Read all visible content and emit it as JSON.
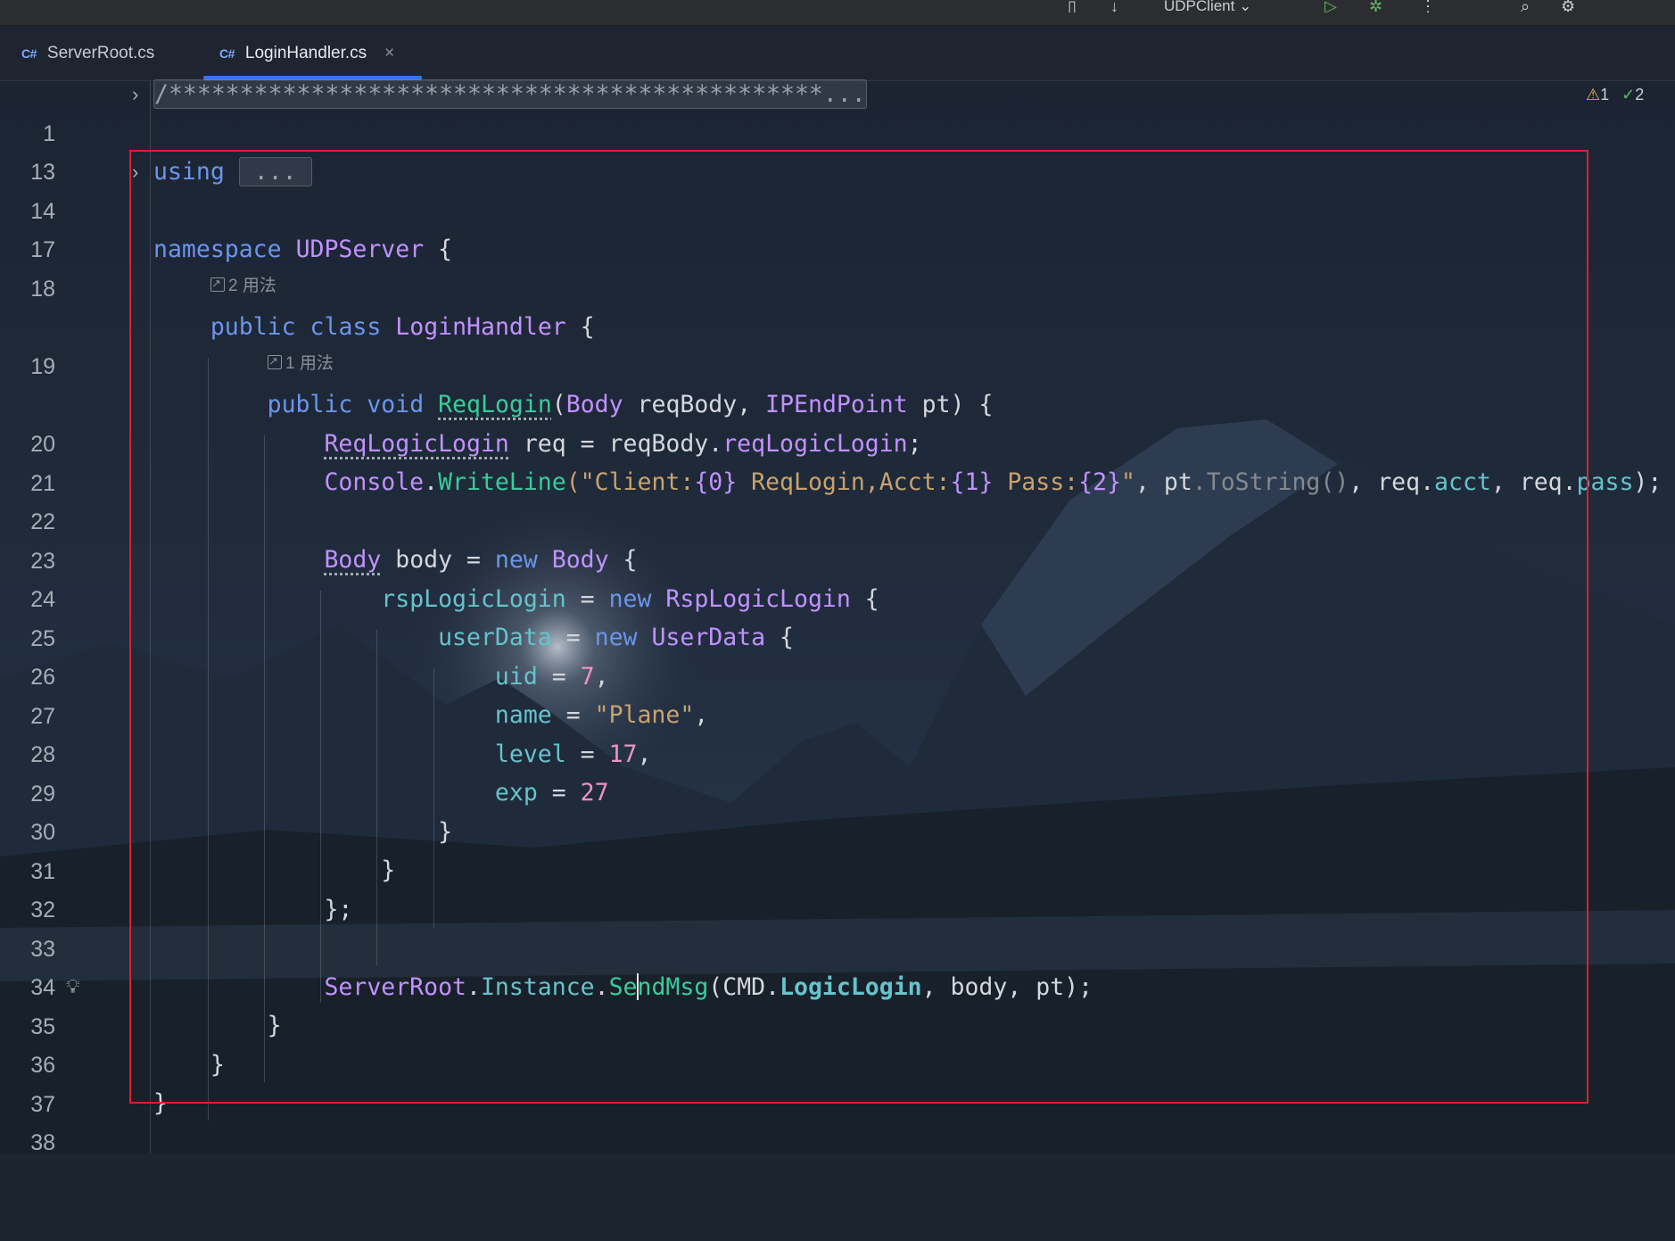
{
  "toolbar": {
    "run_config": "UDPClient"
  },
  "tabs": [
    {
      "icon": "C#",
      "label": "ServerRoot.cs",
      "active": false
    },
    {
      "icon": "C#",
      "label": "LoginHandler.cs",
      "active": true,
      "close": "×"
    }
  ],
  "inspections": {
    "warnings": "1",
    "weak_warnings": "2"
  },
  "hints": {
    "usages_class": "2 用法",
    "usages_method": "1 用法"
  },
  "line_numbers": [
    "1",
    "13",
    "14",
    "17",
    "18",
    "19",
    "20",
    "21",
    "22",
    "23",
    "24",
    "25",
    "26",
    "27",
    "28",
    "29",
    "30",
    "31",
    "32",
    "33",
    "34",
    "35",
    "36",
    "37",
    "38"
  ],
  "code": {
    "l1": "/**********************************************...",
    "l14_kw": "using",
    "l14_fold": " ... ",
    "l18_kw": "namespace",
    "l18_ns": "UDPServer",
    "l18_brace": " {",
    "l19_kw1": "public",
    "l19_kw2": "class",
    "l19_type": "LoginHandler",
    "l19_brace": " {",
    "l20_kw1": "public",
    "l20_kw2": "void",
    "l20_method": "ReqLogin",
    "l20_p1": "(",
    "l20_t1": "Body",
    "l20_a1": " reqBody, ",
    "l20_t2": "IPEndPoint",
    "l20_a2": " pt) {",
    "l21_type": "ReqLogicLogin",
    "l21_rest1": " req = reqBody.",
    "l21_field": "reqLogicLogin",
    "l21_end": ";",
    "l22_type": "Console",
    "l22_dot": ".",
    "l22_method": "WriteLine",
    "l22_p": "(\"",
    "l22_s1": "Client:",
    "l22_f1": "{0}",
    "l22_s2": " ReqLogin,Acct:",
    "l22_f2": "{1}",
    "l22_s3": " Pass:",
    "l22_f3": "{2}",
    "l22_q": "\"",
    "l22_r1": ", pt",
    "l22_gray": ".ToString()",
    "l22_r2": ", req.",
    "l22_acct": "acct",
    "l22_r3": ", req.",
    "l22_pass": "pass",
    "l22_end": ");",
    "l24_type": "Body",
    "l24_mid": " body = ",
    "l24_new": "new",
    "l24_type2": "Body",
    "l24_brace": " {",
    "l25_field": "rspLogicLogin",
    "l25_eq": " = ",
    "l25_new": "new",
    "l25_type": "RspLogicLogin",
    "l25_brace": " {",
    "l26_field": "userData",
    "l26_eq": " = ",
    "l26_new": "new",
    "l26_type": "UserData",
    "l26_brace": " {",
    "l27_field": "uid",
    "l27_eq": " = ",
    "l27_val": "7",
    "l27_end": ",",
    "l28_field": "name",
    "l28_eq": " = ",
    "l28_val": "\"Plane\"",
    "l28_end": ",",
    "l29_field": "level",
    "l29_eq": " = ",
    "l29_val": "17",
    "l29_end": ",",
    "l30_field": "exp",
    "l30_eq": " = ",
    "l30_val": "27",
    "l31": "}",
    "l32": "}",
    "l33": "};",
    "l35_type": "ServerRoot",
    "l35_dot1": ".",
    "l35_prop": "Instance",
    "l35_dot2": ".",
    "l35_m1": "Se",
    "l35_m2": "ndMsg",
    "l35_p": "(CMD.",
    "l35_enum": "LogicLogin",
    "l35_rest": ", body, pt);",
    "l36": "}",
    "l37": "}",
    "l38": "}"
  },
  "colors": {
    "keyword": "#6c95eb",
    "type": "#c191ff",
    "method": "#39cc9b",
    "string": "#c9a26d",
    "number": "#ed94c0",
    "field": "#66c3cc",
    "highlight_box": "#e01e2b",
    "tab_accent": "#3574f0"
  }
}
